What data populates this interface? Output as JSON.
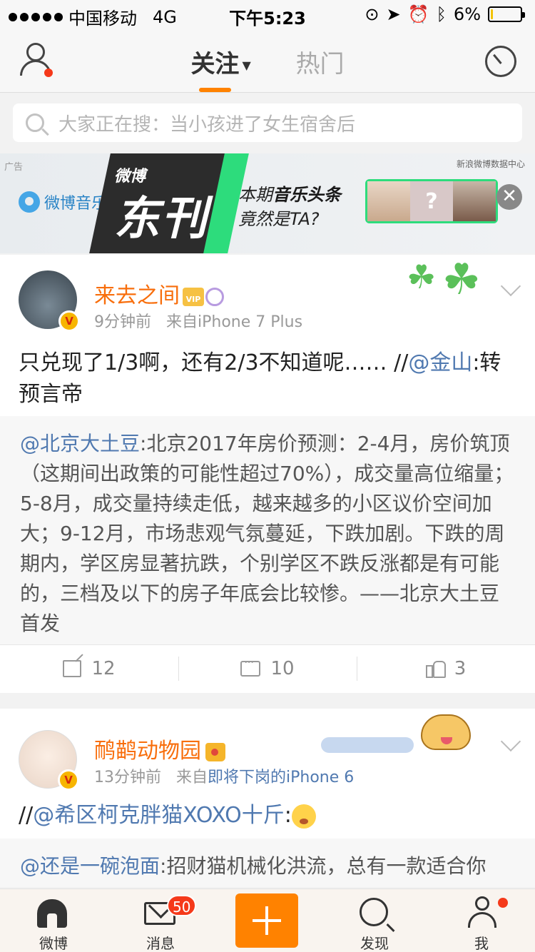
{
  "status_bar": {
    "carrier": "中国移动",
    "network": "4G",
    "time": "下午5:23",
    "battery_percent": "6%",
    "battery_level": 0.06,
    "battery_color": "#f3c300"
  },
  "nav": {
    "tabs": [
      {
        "label": "关注",
        "active": true
      },
      {
        "label": "热门",
        "active": false
      }
    ],
    "accent": "#ff8200"
  },
  "search": {
    "placeholder": "大家正在搜：当小孩进了女生宿舍后"
  },
  "ad_banner": {
    "ad_tag": "广告",
    "brand": "微博音乐",
    "title_small": "微博",
    "title_big": "东刊",
    "headline_line1_prefix": "本期",
    "headline_line1_bold": "音乐头条",
    "headline_line2": "竟然是TA?",
    "data_center": "新浪微博数据中心",
    "mystery": "?"
  },
  "posts": [
    {
      "username": "来去之间",
      "time": "9分钟前",
      "source_prefix": "来自",
      "source": "iPhone 7 Plus",
      "text_before": "只兑现了1/3啊，还有2/3不知道呢…… //",
      "mention": "@金山",
      "text_after": ":转预言帝",
      "repost_mention": "@北京大土豆",
      "repost_text": ":北京2017年房价预测：2-4月，房价筑顶（这期间出政策的可能性超过70%），成交量高位缩量；5-8月，成交量持续走低，越来越多的小区议价空间加大；9-12月，市场悲观气氛蔓延，下跌加剧。下跌的周期内，学区房显著抗跌，个别学区不跌反涨都是有可能的，三档及以下的房子年底会比较惨。——北京大土豆首发",
      "forwards": "12",
      "comments": "10",
      "likes": "3"
    },
    {
      "username": "鸸鹋动物园",
      "time": "13分钟前",
      "source_prefix": "来自",
      "source": "即将下岗的iPhone 6",
      "text_prefix": "//",
      "mention": "@希区柯克胖猫XOXO十斤",
      "text_after": ":",
      "repost_mention": "@还是一碗泡面",
      "repost_text": ":招财猫机械化洪流，总有一款适合你"
    }
  ],
  "tabbar": {
    "items": [
      {
        "label": "微博",
        "icon": "home-icon"
      },
      {
        "label": "消息",
        "icon": "mail-icon",
        "badge": "50"
      },
      {
        "label": "",
        "icon": "plus-icon"
      },
      {
        "label": "发现",
        "icon": "search-icon"
      },
      {
        "label": "我",
        "icon": "profile-icon"
      }
    ]
  },
  "colors": {
    "username": "#f86e0c",
    "link": "#5079b0",
    "badge_red": "#f5391a"
  }
}
